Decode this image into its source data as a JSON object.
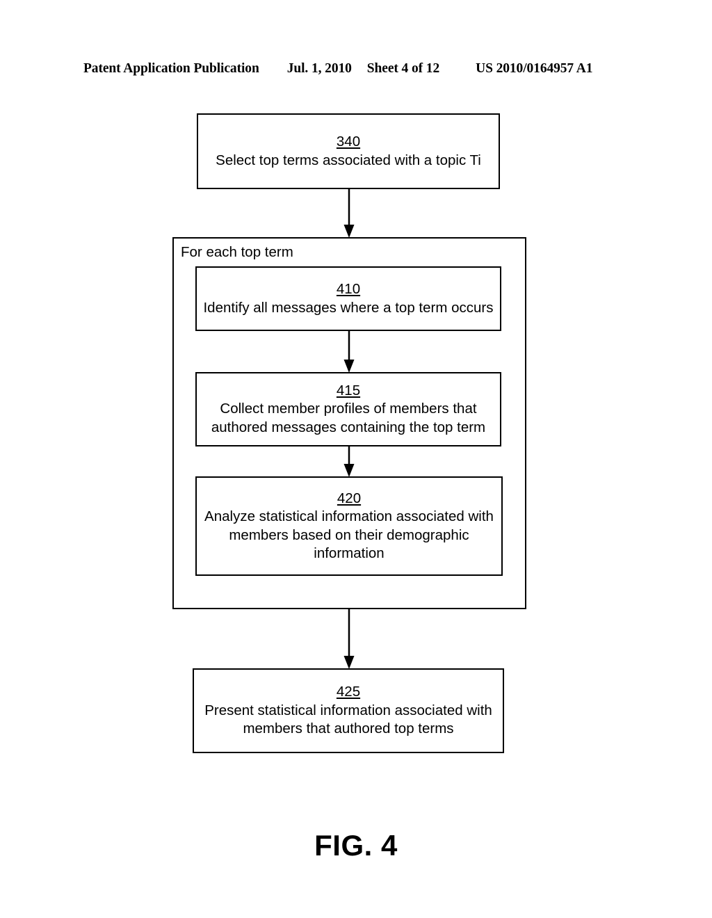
{
  "header": {
    "publication": "Patent Application Publication",
    "date": "Jul. 1, 2010",
    "sheet": "Sheet 4 of 12",
    "patent_number": "US 2010/0164957 A1"
  },
  "figure": {
    "caption": "FIG. 4"
  },
  "flowchart": {
    "loop_label": "For each top term",
    "nodes": [
      {
        "ref": "340",
        "text": "Select top terms associated with a topic Ti"
      },
      {
        "ref": "410",
        "text": "Identify all messages where a top term occurs"
      },
      {
        "ref": "415",
        "text": "Collect member profiles of members that authored messages containing the top term"
      },
      {
        "ref": "420",
        "text": "Analyze statistical information associated with members based on their demographic information"
      },
      {
        "ref": "425",
        "text": "Present statistical information associated with members that authored top terms"
      }
    ]
  },
  "colors": {
    "ink": "#000000",
    "page": "#ffffff"
  }
}
